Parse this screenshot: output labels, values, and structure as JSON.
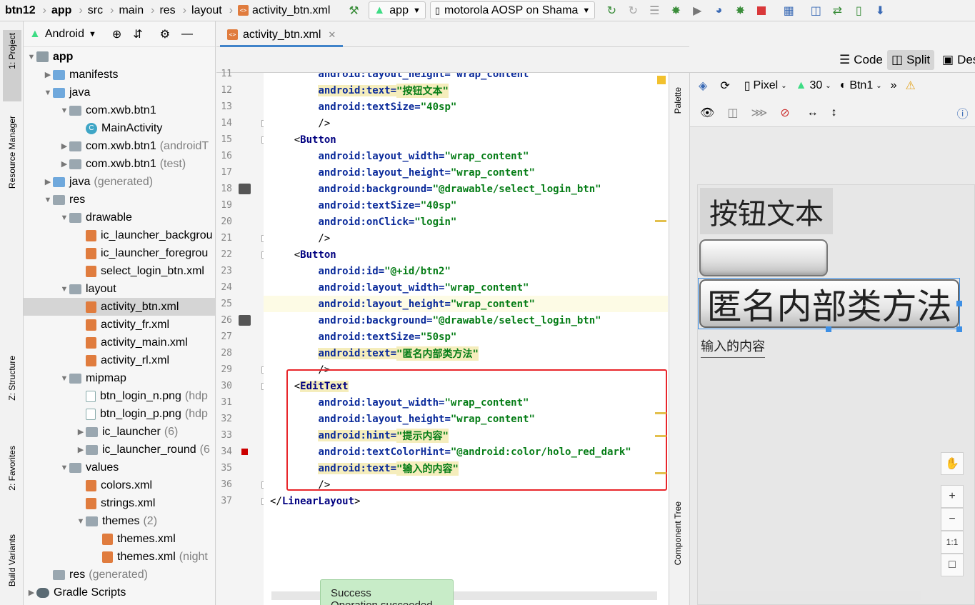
{
  "breadcrumb": [
    "btn12",
    "app",
    "src",
    "main",
    "res",
    "layout",
    "activity_btn.xml"
  ],
  "toolbar": {
    "run_config": "app",
    "device": "motorola AOSP on Shama"
  },
  "left_strip": {
    "project": "1: Project",
    "resource_manager": "Resource Manager",
    "structure": "Z: Structure",
    "favorites": "2: Favorites",
    "build_variants": "Build Variants"
  },
  "project_panel": {
    "view": "Android",
    "tree": [
      {
        "label": "app",
        "extra": "",
        "bold": true
      },
      {
        "label": "manifests",
        "extra": ""
      },
      {
        "label": "java",
        "extra": ""
      },
      {
        "label": "com.xwb.btn1",
        "extra": ""
      },
      {
        "label": "MainActivity",
        "extra": ""
      },
      {
        "label": "com.xwb.btn1",
        "extra": "(androidT"
      },
      {
        "label": "com.xwb.btn1",
        "extra": "(test)"
      },
      {
        "label": "java",
        "extra": "(generated)"
      },
      {
        "label": "res",
        "extra": ""
      },
      {
        "label": "drawable",
        "extra": ""
      },
      {
        "label": "ic_launcher_backgrou",
        "extra": ""
      },
      {
        "label": "ic_launcher_foregrou",
        "extra": ""
      },
      {
        "label": "select_login_btn.xml",
        "extra": ""
      },
      {
        "label": "layout",
        "extra": ""
      },
      {
        "label": "activity_btn.xml",
        "extra": ""
      },
      {
        "label": "activity_fr.xml",
        "extra": ""
      },
      {
        "label": "activity_main.xml",
        "extra": ""
      },
      {
        "label": "activity_rl.xml",
        "extra": ""
      },
      {
        "label": "mipmap",
        "extra": ""
      },
      {
        "label": "btn_login_n.png",
        "extra": "(hdp"
      },
      {
        "label": "btn_login_p.png",
        "extra": "(hdp"
      },
      {
        "label": "ic_launcher",
        "extra": "(6)"
      },
      {
        "label": "ic_launcher_round",
        "extra": "(6"
      },
      {
        "label": "values",
        "extra": ""
      },
      {
        "label": "colors.xml",
        "extra": ""
      },
      {
        "label": "strings.xml",
        "extra": ""
      },
      {
        "label": "themes",
        "extra": "(2)"
      },
      {
        "label": "themes.xml",
        "extra": ""
      },
      {
        "label": "themes.xml",
        "extra": "(night"
      },
      {
        "label": "res",
        "extra": "(generated)"
      },
      {
        "label": "Gradle Scripts",
        "extra": ""
      }
    ]
  },
  "editor": {
    "tab": "activity_btn.xml",
    "view_modes": [
      "Code",
      "Split",
      "Des"
    ],
    "lines": [
      {
        "n": "11",
        "parts": [
          [
            "at",
            "        android:layout_height=\"wrap_content\""
          ]
        ]
      },
      {
        "n": "12",
        "parts": [
          [
            "sp",
            "        "
          ],
          [
            "athl",
            "android:text="
          ],
          [
            "valhl",
            "\"按钮文本\""
          ]
        ]
      },
      {
        "n": "13",
        "parts": [
          [
            "sp",
            "        "
          ],
          [
            "at",
            "android:textSize="
          ],
          [
            "val",
            "\"40sp\""
          ]
        ]
      },
      {
        "n": "14",
        "parts": [
          [
            "pn",
            "        />"
          ]
        ]
      },
      {
        "n": "15",
        "parts": [
          [
            "pn",
            "    <"
          ],
          [
            "tag",
            "Button"
          ]
        ]
      },
      {
        "n": "16",
        "parts": [
          [
            "sp",
            "        "
          ],
          [
            "at",
            "android:layout_width="
          ],
          [
            "val",
            "\"wrap_content\""
          ]
        ]
      },
      {
        "n": "17",
        "parts": [
          [
            "sp",
            "        "
          ],
          [
            "at",
            "android:layout_height="
          ],
          [
            "val",
            "\"wrap_content\""
          ]
        ]
      },
      {
        "n": "18",
        "parts": [
          [
            "sp",
            "        "
          ],
          [
            "at",
            "android:background="
          ],
          [
            "val",
            "\"@drawable/select_login_btn\""
          ]
        ]
      },
      {
        "n": "19",
        "parts": [
          [
            "sp",
            "        "
          ],
          [
            "at",
            "android:textSize="
          ],
          [
            "val",
            "\"40sp\""
          ]
        ]
      },
      {
        "n": "20",
        "parts": [
          [
            "sp",
            "        "
          ],
          [
            "at",
            "android:onClick="
          ],
          [
            "val",
            "\"login\""
          ]
        ]
      },
      {
        "n": "21",
        "parts": [
          [
            "pn",
            "        />"
          ]
        ]
      },
      {
        "n": "22",
        "parts": [
          [
            "pn",
            "    <"
          ],
          [
            "tag",
            "Button"
          ]
        ]
      },
      {
        "n": "23",
        "parts": [
          [
            "sp",
            "        "
          ],
          [
            "at",
            "android:id="
          ],
          [
            "val",
            "\"@+id/btn2\""
          ]
        ]
      },
      {
        "n": "24",
        "parts": [
          [
            "sp",
            "        "
          ],
          [
            "at",
            "android:layout_width="
          ],
          [
            "val",
            "\"wrap_content\""
          ]
        ]
      },
      {
        "n": "25",
        "parts": [
          [
            "sp",
            "        "
          ],
          [
            "at",
            "android:layout_height="
          ],
          [
            "val",
            "\"wrap_content\""
          ]
        ]
      },
      {
        "n": "26",
        "parts": [
          [
            "sp",
            "        "
          ],
          [
            "at",
            "android:background="
          ],
          [
            "val",
            "\"@drawable/select_login_btn\""
          ]
        ]
      },
      {
        "n": "27",
        "parts": [
          [
            "sp",
            "        "
          ],
          [
            "at",
            "android:textSize="
          ],
          [
            "val",
            "\"50sp\""
          ]
        ]
      },
      {
        "n": "28",
        "parts": [
          [
            "sp",
            "        "
          ],
          [
            "athl",
            "android:text="
          ],
          [
            "valhl",
            "\"匿名内部类方法\""
          ]
        ]
      },
      {
        "n": "29",
        "parts": [
          [
            "pn",
            "        />"
          ]
        ]
      },
      {
        "n": "30",
        "parts": [
          [
            "pn",
            "    <"
          ],
          [
            "taghl",
            "EditText"
          ]
        ]
      },
      {
        "n": "31",
        "parts": [
          [
            "sp",
            "        "
          ],
          [
            "at",
            "android:layout_width="
          ],
          [
            "val",
            "\"wrap_content\""
          ]
        ]
      },
      {
        "n": "32",
        "parts": [
          [
            "sp",
            "        "
          ],
          [
            "at",
            "android:layout_height="
          ],
          [
            "val",
            "\"wrap_content\""
          ]
        ]
      },
      {
        "n": "33",
        "parts": [
          [
            "sp",
            "        "
          ],
          [
            "athl",
            "android:hint="
          ],
          [
            "valhl",
            "\"提示内容\""
          ]
        ]
      },
      {
        "n": "34",
        "parts": [
          [
            "sp",
            "        "
          ],
          [
            "at",
            "android:textColorHint="
          ],
          [
            "val",
            "\"@android:color/holo_red_dark\""
          ]
        ]
      },
      {
        "n": "35",
        "parts": [
          [
            "sp",
            "        "
          ],
          [
            "athl",
            "android:text="
          ],
          [
            "valhl",
            "\"输入的内容\""
          ]
        ]
      },
      {
        "n": "36",
        "parts": [
          [
            "pn",
            "        />"
          ]
        ]
      },
      {
        "n": "37",
        "parts": [
          [
            "pn",
            "</"
          ],
          [
            "tag",
            "LinearLayout"
          ],
          [
            "pn",
            ">"
          ]
        ]
      }
    ]
  },
  "toast": {
    "title": "Success",
    "body": "Operation succeeded"
  },
  "palette_strip": {
    "palette": "Palette",
    "component_tree": "Component Tree"
  },
  "design": {
    "device": "Pixel",
    "api": "30",
    "theme": "Btn1",
    "button1_text": "按钮文本",
    "button3_text": "匿名内部类方法",
    "edittext_text": "输入的内容",
    "zoom_fit_label": "1:1"
  },
  "colors": {
    "selection": "#3d8fe5",
    "highlight_box": "#e8262b",
    "string_green": "#067d17",
    "attr_blue": "#0a2a9a"
  }
}
